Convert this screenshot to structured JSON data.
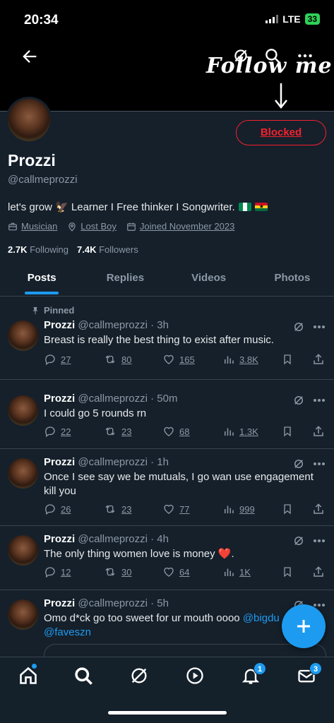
{
  "status_bar": {
    "time": "20:34",
    "network": "LTE",
    "battery": "33"
  },
  "banner": {
    "overlay_text": "Follow me"
  },
  "profile": {
    "name": "Prozzi",
    "handle": "@callmeprozzi",
    "bio": "let's grow 🦅 Learner I Free thinker I Songwriter.",
    "category": "Musician",
    "location": "Lost Boy",
    "joined": "Joined November 2023",
    "following_count": "2.7K",
    "following_label": "Following",
    "followers_count": "7.4K",
    "followers_label": "Followers",
    "action_button": "Blocked"
  },
  "tabs": [
    {
      "label": "Posts",
      "active": true
    },
    {
      "label": "Replies",
      "active": false
    },
    {
      "label": "Videos",
      "active": false
    },
    {
      "label": "Photos",
      "active": false
    }
  ],
  "pinned_label": "Pinned",
  "posts": [
    {
      "name": "Prozzi",
      "meta": "@callmeprozzi · 3h",
      "text": "Breast is really the best thing to exist after music.",
      "replies": "27",
      "reposts": "80",
      "likes": "165",
      "views": "3.8K"
    },
    {
      "name": "Prozzi",
      "meta": "@callmeprozzi · 50m",
      "text": "I could go 5 rounds rn",
      "replies": "22",
      "reposts": "23",
      "likes": "68",
      "views": "1.3K"
    },
    {
      "name": "Prozzi",
      "meta": "@callmeprozzi · 1h",
      "text": "Once I see say we be mutuals, I go wan use engagement kill you",
      "replies": "26",
      "reposts": "23",
      "likes": "77",
      "views": "999"
    },
    {
      "name": "Prozzi",
      "meta": "@callmeprozzi · 4h",
      "text": "The only thing women love is money ❤️.",
      "replies": "12",
      "reposts": "30",
      "likes": "64",
      "views": "1K"
    },
    {
      "name": "Prozzi",
      "meta": "@callmeprozzi · 5h",
      "text": "Omo d*ck go too sweet for ur mouth oooo",
      "mention1": "@bigdu",
      "mention2": "@faveszn"
    }
  ],
  "nav": {
    "notifications_badge": "1",
    "messages_badge": "3"
  },
  "colors": {
    "accent": "#1d9bf0",
    "blocked": "#f4212e",
    "background": "#15202b"
  }
}
